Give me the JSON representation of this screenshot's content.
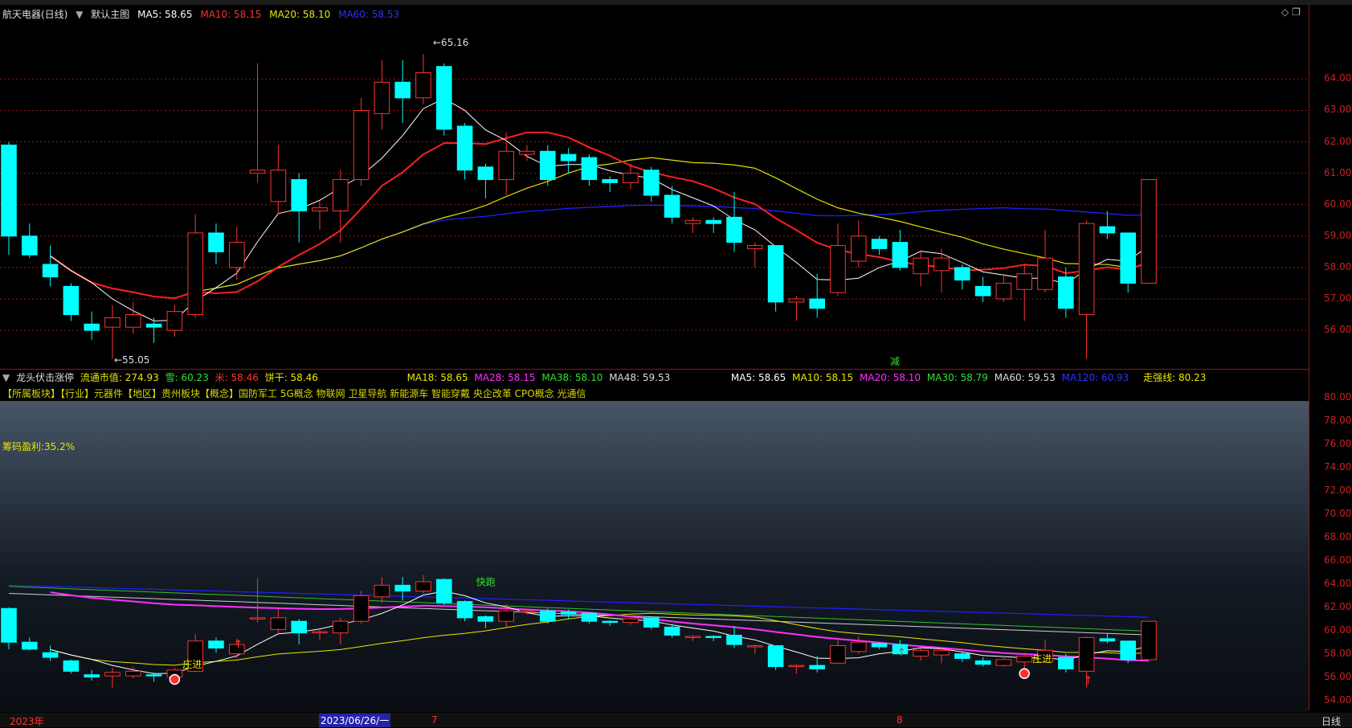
{
  "header": {
    "stock": "航天电器(日线)",
    "main_chart": "默认主图",
    "ma5": "MA5: 58.65",
    "ma10": "MA10: 58.15",
    "ma20": "MA20: 58.10",
    "ma60": "MA60: 58.53"
  },
  "annotations": {
    "high": "65.16",
    "low": "55.05",
    "reduce": "减"
  },
  "y_axis_main": [
    "64.00",
    "63.00",
    "62.00",
    "61.00",
    "60.00",
    "59.00",
    "58.00",
    "57.00",
    "56.00"
  ],
  "y_axis_lower": [
    "80.00",
    "78.00",
    "76.00",
    "74.00",
    "72.00",
    "70.00",
    "68.00",
    "66.00",
    "64.00",
    "62.00",
    "60.00",
    "58.00",
    "56.00",
    "54.00"
  ],
  "indicator": {
    "name": "龙头伏击涨停",
    "float_cap": "流通市值: 274.93",
    "xue": "雪: 60.23",
    "mi": "米: 58.46",
    "bing": "饼干: 58.46",
    "ma18": "MA18: 58.65",
    "ma28": "MA28: 58.15",
    "ma38": "MA38: 58.10",
    "ma48": "MA48: 59.53",
    "ma5b": "MA5: 58.65",
    "ma10b": "MA10: 58.15",
    "ma20b": "MA20: 58.10",
    "ma30b": "MA30: 58.79",
    "ma60b": "MA60: 59.53",
    "ma120b": "MA120: 60.93",
    "strong": "走强线: 80.23"
  },
  "tags": "【所属板块】【行业】元器件【地区】贵州板块【概念】国防军工 5G概念 物联网 卫星导航 新能源车 智能穿戴 央企改革 CPO概念 光通信",
  "profit": "筹码盈利:35.2%",
  "signals": {
    "enter1": "庄进",
    "enter2": "庄进",
    "run": "快跑"
  },
  "bottom_bar": {
    "year": "2023年",
    "date": "2023/06/26/一",
    "m7": "7",
    "m8": "8",
    "period": "日线"
  },
  "colors": {
    "up": "#ff3333",
    "down": "#00ffff",
    "ma5": "#ffffff",
    "ma10": "#ff2020",
    "ma20": "#e0e000",
    "ma60": "#2020ff"
  },
  "chart_data": {
    "type": "candlestick",
    "days": [
      [
        61.9,
        59.0,
        62.0,
        58.4
      ],
      [
        59.0,
        58.4,
        59.4,
        58.3
      ],
      [
        58.1,
        57.7,
        58.7,
        57.4
      ],
      [
        57.4,
        56.5,
        57.5,
        56.3
      ],
      [
        56.2,
        56.0,
        56.6,
        55.7
      ],
      [
        56.1,
        56.4,
        56.8,
        55.1
      ],
      [
        56.1,
        56.5,
        56.9,
        55.9
      ],
      [
        56.2,
        56.1,
        56.4,
        55.6
      ],
      [
        56.0,
        56.6,
        56.8,
        55.8
      ],
      [
        56.5,
        59.1,
        59.7,
        56.4
      ],
      [
        59.1,
        58.5,
        59.4,
        58.1
      ],
      [
        58.0,
        58.8,
        59.3,
        57.6
      ],
      [
        61.0,
        61.1,
        64.5,
        60.7
      ],
      [
        60.1,
        61.1,
        61.9,
        59.7
      ],
      [
        60.8,
        59.8,
        61.0,
        58.8
      ],
      [
        59.8,
        59.9,
        60.1,
        59.2
      ],
      [
        59.8,
        60.8,
        61.1,
        58.8
      ],
      [
        60.8,
        63.0,
        63.4,
        60.6
      ],
      [
        62.9,
        63.9,
        64.6,
        62.4
      ],
      [
        63.9,
        63.4,
        64.6,
        62.6
      ],
      [
        63.4,
        64.2,
        64.8,
        63.2
      ],
      [
        64.4,
        62.4,
        64.5,
        62.2
      ],
      [
        62.5,
        61.1,
        62.6,
        60.8
      ],
      [
        61.2,
        60.8,
        61.3,
        60.2
      ],
      [
        60.8,
        61.7,
        62.3,
        60.3
      ],
      [
        61.6,
        61.7,
        61.9,
        61.4
      ],
      [
        61.7,
        60.8,
        61.9,
        60.6
      ],
      [
        61.6,
        61.4,
        61.8,
        61.0
      ],
      [
        61.5,
        60.8,
        61.6,
        60.6
      ],
      [
        60.8,
        60.7,
        60.9,
        60.4
      ],
      [
        60.7,
        61.0,
        61.3,
        60.5
      ],
      [
        61.1,
        60.3,
        61.2,
        60.1
      ],
      [
        60.3,
        59.6,
        60.6,
        59.4
      ],
      [
        59.4,
        59.5,
        59.6,
        59.1
      ],
      [
        59.5,
        59.4,
        59.6,
        59.1
      ],
      [
        59.6,
        58.8,
        60.4,
        58.5
      ],
      [
        58.6,
        58.7,
        58.8,
        58.0
      ],
      [
        58.7,
        56.9,
        58.7,
        56.6
      ],
      [
        56.9,
        57.0,
        57.1,
        56.3
      ],
      [
        57.0,
        56.7,
        57.8,
        56.4
      ],
      [
        57.2,
        58.7,
        59.4,
        57.1
      ],
      [
        58.2,
        59.0,
        59.5,
        58.0
      ],
      [
        58.9,
        58.6,
        59.0,
        58.4
      ],
      [
        58.8,
        58.0,
        59.2,
        57.9
      ],
      [
        57.8,
        58.3,
        58.5,
        57.4
      ],
      [
        57.9,
        58.3,
        58.6,
        57.2
      ],
      [
        58.0,
        57.6,
        58.1,
        57.3
      ],
      [
        57.4,
        57.1,
        57.7,
        56.9
      ],
      [
        57.0,
        57.5,
        57.8,
        56.9
      ],
      [
        57.3,
        57.8,
        58.1,
        56.3
      ],
      [
        57.3,
        58.3,
        59.2,
        57.2
      ],
      [
        57.7,
        56.7,
        58.0,
        56.4
      ],
      [
        56.5,
        59.4,
        59.5,
        55.1
      ],
      [
        59.3,
        59.1,
        59.8,
        58.9
      ],
      [
        59.1,
        57.5,
        59.1,
        57.2
      ],
      [
        57.5,
        60.8,
        60.8,
        57.5
      ]
    ]
  }
}
